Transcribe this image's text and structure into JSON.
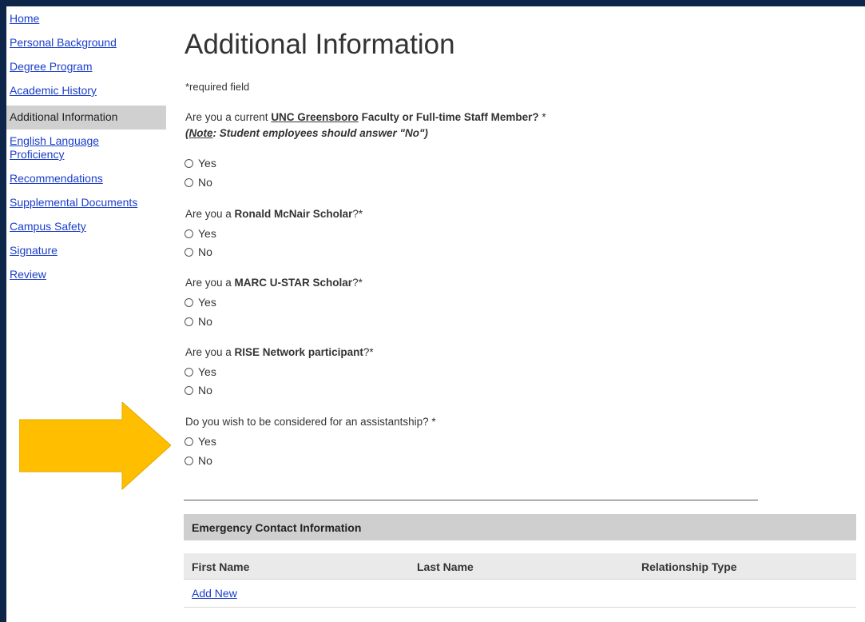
{
  "sidebar": {
    "items": [
      {
        "label": "Home"
      },
      {
        "label": "Personal Background"
      },
      {
        "label": "Degree Program"
      },
      {
        "label": "Academic History"
      },
      {
        "label": "Additional Information"
      },
      {
        "label": "English Language Proficiency"
      },
      {
        "label": "Recommendations"
      },
      {
        "label": "Supplemental Documents"
      },
      {
        "label": "Campus Safety"
      },
      {
        "label": "Signature"
      },
      {
        "label": "Review"
      }
    ]
  },
  "main": {
    "title": "Additional Information",
    "required_note": "*required field",
    "q1": {
      "prefix": "Are you a current ",
      "org": "UNC Greensboro",
      "bold": " Faculty or Full-time Staff Member?",
      "suffix": " *",
      "note_label": "Note",
      "note_text": ": Student employees should answer \"No\")",
      "note_open": "("
    },
    "q2": {
      "prefix": "Are you a ",
      "bold": "Ronald McNair Scholar",
      "suffix": "?*"
    },
    "q3": {
      "prefix": "Are you a ",
      "bold": "MARC U-STAR Scholar",
      "suffix": "?*"
    },
    "q4": {
      "prefix": "Are you a ",
      "bold": "RISE Network participant",
      "suffix": "?*"
    },
    "q5": {
      "text": "Do you wish to be considered for an assistantship? *"
    },
    "options": {
      "yes": "Yes",
      "no": "No"
    },
    "emergency": {
      "header": "Emergency Contact Information",
      "columns": [
        "First Name",
        "Last Name",
        "Relationship Type"
      ],
      "add_new": "Add New"
    }
  },
  "colors": {
    "background": "#0c2548",
    "link": "#1a3ec9",
    "arrow": "#ffbf00"
  },
  "icons": {
    "arrow": "arrow-right-icon"
  }
}
